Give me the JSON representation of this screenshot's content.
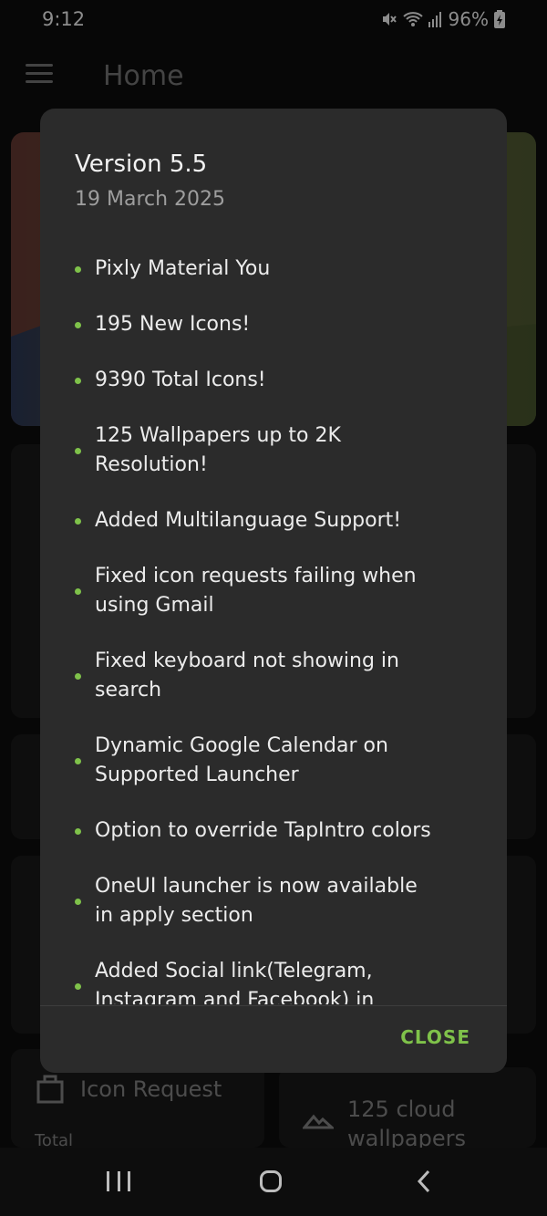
{
  "status_bar": {
    "time": "9:12",
    "battery": "96%",
    "icons": [
      "mute-icon",
      "wifi-icon",
      "signal-icon",
      "battery-icon"
    ]
  },
  "app_bar": {
    "menu_icon": "hamburger-menu-icon",
    "title": "Home"
  },
  "background": {
    "icon_request_label": "Icon Request",
    "total_label": "Total",
    "wallpapers_line1": "125 cloud",
    "wallpapers_line2": "wallpapers"
  },
  "dialog": {
    "title": "Version 5.5",
    "date": "19 March 2025",
    "changes": [
      {
        "line1": "Pixly Material You",
        "line2": ""
      },
      {
        "line1": "195 New Icons!",
        "line2": ""
      },
      {
        "line1": "9390 Total Icons!",
        "line2": ""
      },
      {
        "line1": "125 Wallpapers up to 2K",
        "line2": "Resolution!"
      },
      {
        "line1": "Added Multilanguage Support!",
        "line2": ""
      },
      {
        "line1": "Fixed icon requests failing when",
        "line2": "using Gmail"
      },
      {
        "line1": "Fixed keyboard not showing in",
        "line2": "search"
      },
      {
        "line1": "Dynamic Google Calendar on",
        "line2": "Supported Launcher"
      },
      {
        "line1": "Option to override TapIntro colors",
        "line2": ""
      },
      {
        "line1": "OneUI launcher is now available",
        "line2": "in apply section"
      },
      {
        "line1": "Added Social link(Telegram,",
        "line2": "Instagram and Facebook) in"
      }
    ],
    "close_label": "CLOSE",
    "accent_color": "#7fc24a"
  },
  "nav_bar": {
    "icons": [
      "recents-icon",
      "home-icon",
      "back-icon"
    ]
  }
}
